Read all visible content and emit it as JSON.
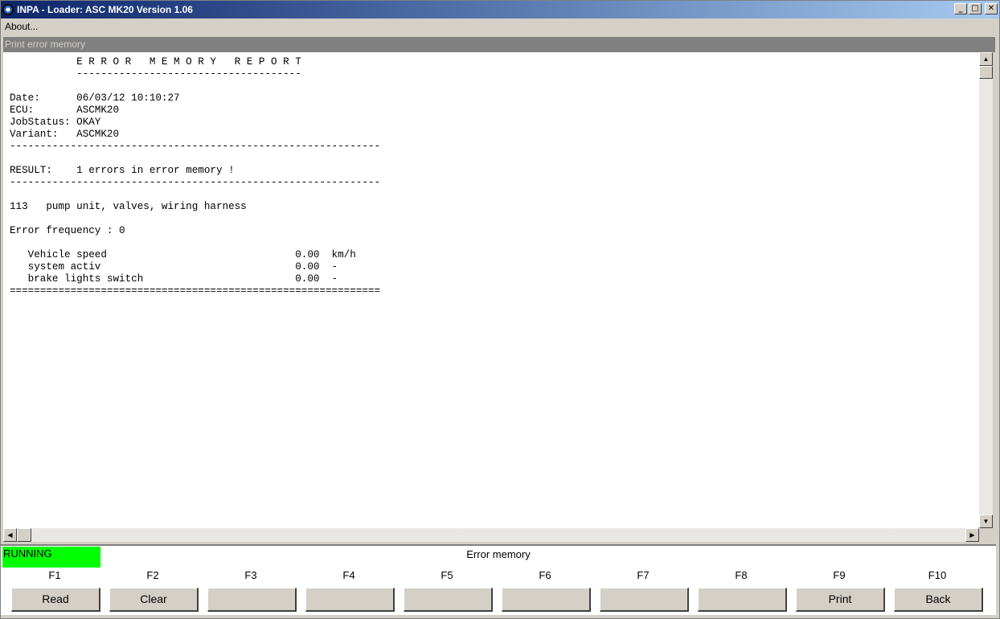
{
  "window": {
    "title": "INPA - Loader:  ASC MK20 Version 1.06",
    "minimize_glyph": "_",
    "maximize_glyph": "□",
    "close_glyph": "✕"
  },
  "menu": {
    "about_label": "About..."
  },
  "child_window": {
    "title": "Print error memory"
  },
  "report": {
    "text": "           E R R O R   M E M O R Y   R E P O R T\n           -------------------------------------\n\nDate:      06/03/12 10:10:27\nECU:       ASCMK20\nJobStatus: OKAY\nVariant:   ASCMK20\n-------------------------------------------------------------\n\nRESULT:    1 errors in error memory !\n-------------------------------------------------------------\n\n113   pump unit, valves, wiring harness\n\nError frequency : 0\n\n   Vehicle speed                               0.00  km/h\n   system activ                                0.00  -\n   brake lights switch                         0.00  -\n============================================================="
  },
  "scrollbars": {
    "up_glyph": "▲",
    "down_glyph": "▼",
    "left_glyph": "◀",
    "right_glyph": "▶"
  },
  "status": {
    "state": "RUNNING",
    "state_color": "#00ff00",
    "screen_title": "Error memory"
  },
  "function_keys": [
    {
      "key": "F1",
      "label": "Read"
    },
    {
      "key": "F2",
      "label": "Clear"
    },
    {
      "key": "F3",
      "label": ""
    },
    {
      "key": "F4",
      "label": ""
    },
    {
      "key": "F5",
      "label": ""
    },
    {
      "key": "F6",
      "label": ""
    },
    {
      "key": "F7",
      "label": ""
    },
    {
      "key": "F8",
      "label": ""
    },
    {
      "key": "F9",
      "label": "Print"
    },
    {
      "key": "F10",
      "label": "Back"
    }
  ]
}
